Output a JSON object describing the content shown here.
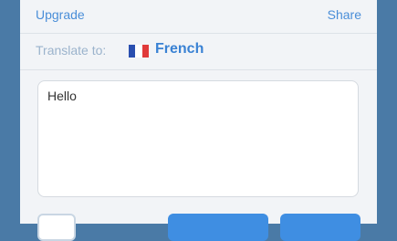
{
  "header": {
    "upgrade_label": "Upgrade",
    "share_label": "Share"
  },
  "translate": {
    "prefix": "Translate to:",
    "language": "French",
    "flag_icon": "french-flag-icon"
  },
  "input": {
    "value": "Hello"
  },
  "colors": {
    "background": "#4a7aa6",
    "accent": "#3f8ee2",
    "link": "#4a8ed8"
  }
}
